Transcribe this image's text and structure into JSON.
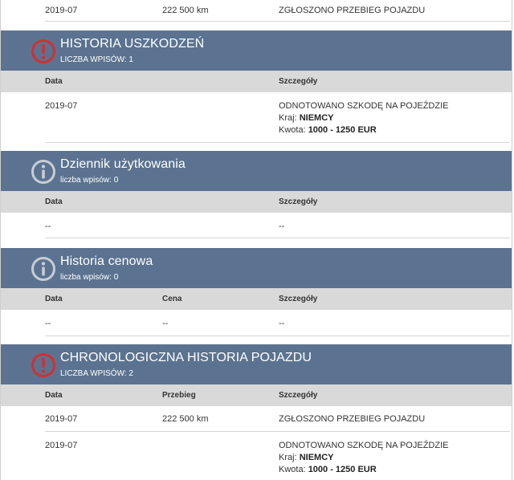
{
  "top_row": {
    "date": "2019-07",
    "mileage": "222 500 km",
    "details": "ZGŁOSZONO PRZEBIEG POJAZDU"
  },
  "damage": {
    "title": "HISTORIA USZKODZEŃ",
    "count": "LICZBA WPISÓW: 1",
    "icon": "alert-icon",
    "col_date": "Data",
    "col_details": "Szczegóły",
    "row": {
      "date": "2019-07",
      "line1": "ODNOTOWANO SZKODĘ NA POJEŹDZIE",
      "country_label": "Kraj: ",
      "country_value": "NIEMCY",
      "amount_label": "Kwota: ",
      "amount_value": "1000 - 1250 EUR"
    }
  },
  "usage": {
    "title": "Dziennik użytkowania",
    "count": "liczba wpisów: 0",
    "icon": "info-icon",
    "col_date": "Data",
    "col_details": "Szczegóły",
    "empty_date": "--",
    "empty_details": "--"
  },
  "price": {
    "title": "Historia cenowa",
    "count": "liczba wpisów: 0",
    "icon": "info-icon",
    "col_date": "Data",
    "col_price": "Cena",
    "col_details": "Szczegóły",
    "empty_date": "--",
    "empty_price": "--",
    "empty_details": "--"
  },
  "chrono": {
    "title": "CHRONOLOGICZNA HISTORIA POJAZDU",
    "count": "LICZBA WPISÓW: 2",
    "icon": "alert-icon",
    "col_date": "Data",
    "col_mileage": "Przebieg",
    "col_details": "Szczegóły",
    "row1": {
      "date": "2019-07",
      "mileage": "222 500 km",
      "details": "ZGŁOSZONO PRZEBIEG POJAZDU"
    },
    "row2": {
      "date": "2019-07",
      "line1": "ODNOTOWANO SZKODĘ NA POJEŹDZIE",
      "country_label": "Kraj: ",
      "country_value": "NIEMCY",
      "amount_label": "Kwota: ",
      "amount_value": "1000 - 1250 EUR"
    }
  },
  "colors": {
    "header": "#5b7390",
    "col_head": "#d9d9d9",
    "alert": "#d32f2f",
    "info": "#c8cdd4"
  }
}
